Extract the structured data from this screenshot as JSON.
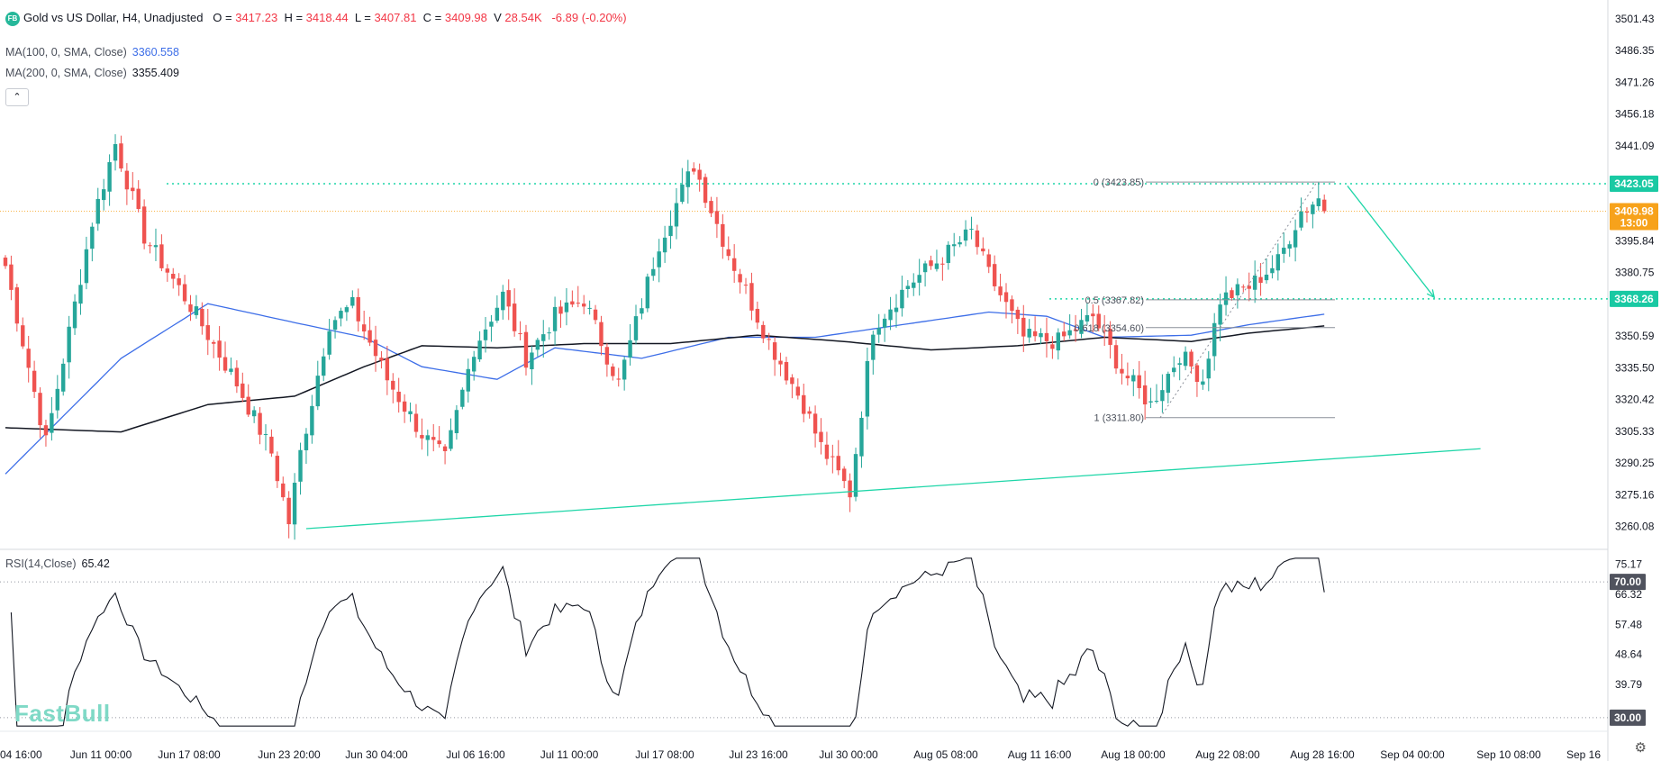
{
  "header": {
    "logo": "FB",
    "symbol_title": "Gold vs US Dollar, H4, Unadjusted",
    "ohlc": [
      {
        "key": "O",
        "value": "3417.23"
      },
      {
        "key": "H",
        "value": "3418.44"
      },
      {
        "key": "L",
        "value": "3407.81"
      },
      {
        "key": "C",
        "value": "3409.98"
      },
      {
        "key": "V",
        "value": "28.54K"
      }
    ],
    "change": "-6.89 (-0.20%)"
  },
  "indicators": {
    "ma100_label": "MA(100, 0, SMA, Close)",
    "ma100_value": "3360.558",
    "ma200_label": "MA(200, 0, SMA, Close)",
    "ma200_value": "3355.409",
    "rsi_label": "RSI(14,Close)",
    "rsi_value": "65.42",
    "collapse_icon": "chevron-up-icon"
  },
  "watermark": "FastBull",
  "colors": {
    "up": "#26a69a",
    "down": "#ef5350",
    "ma100": "#3d6ee8",
    "ma200": "#131722",
    "teal": "#1fd6a8",
    "price_tag": "#f7a21b",
    "level_tag": "#19c9a3"
  },
  "chart_data": {
    "type": "candlestick",
    "price_axis": {
      "ticks": [
        "3501.43",
        "3486.35",
        "3471.26",
        "3456.18",
        "3441.09",
        "3395.84",
        "3380.75",
        "3350.59",
        "3335.50",
        "3320.42",
        "3305.33",
        "3290.25",
        "3275.16",
        "3260.08"
      ],
      "tick_values": [
        3501.43,
        3486.35,
        3471.26,
        3456.18,
        3441.09,
        3395.84,
        3380.75,
        3350.59,
        3335.5,
        3320.42,
        3305.33,
        3290.25,
        3275.16,
        3260.08
      ],
      "range": [
        3250,
        3507
      ]
    },
    "time_axis": [
      "04 16:00",
      "Jun 11 00:00",
      "Jun 17 08:00",
      "Jun 23 20:00",
      "Jun 30 04:00",
      "Jul 06 16:00",
      "Jul 11 00:00",
      "Jul 17 08:00",
      "Jul 23 16:00",
      "Jul 30 00:00",
      "Aug 05 08:00",
      "Aug 11 16:00",
      "Aug 18 00:00",
      "Aug 22 08:00",
      "Aug 28 16:00",
      "Sep 04 00:00",
      "Sep 10 08:00",
      "Sep 16"
    ],
    "key_prices": [
      {
        "label": "3423.05",
        "value": 3423.05,
        "style": "level"
      },
      {
        "label": "3409.98",
        "sub": "13:00",
        "value": 3409.98,
        "style": "last"
      },
      {
        "label": "3368.26",
        "value": 3368.26,
        "style": "level"
      }
    ],
    "fibonacci": [
      {
        "label": "0 (3423.85)",
        "value": 3423.85
      },
      {
        "label": "0.5 (3367.82)",
        "value": 3367.82
      },
      {
        "label": "0.618 (3354.60)",
        "value": 3354.6
      },
      {
        "label": "1 (3311.80)",
        "value": 3311.8
      }
    ],
    "anchors": [
      [
        0,
        3384
      ],
      [
        7,
        3300
      ],
      [
        15,
        3405
      ],
      [
        19,
        3442
      ],
      [
        24,
        3398
      ],
      [
        32,
        3365
      ],
      [
        40,
        3328
      ],
      [
        46,
        3295
      ],
      [
        49,
        3262
      ],
      [
        51,
        3295
      ],
      [
        56,
        3357
      ],
      [
        60,
        3365
      ],
      [
        66,
        3330
      ],
      [
        72,
        3304
      ],
      [
        76,
        3292
      ],
      [
        81,
        3345
      ],
      [
        86,
        3370
      ],
      [
        90,
        3340
      ],
      [
        95,
        3360
      ],
      [
        100,
        3368
      ],
      [
        106,
        3328
      ],
      [
        113,
        3395
      ],
      [
        119,
        3432
      ],
      [
        125,
        3390
      ],
      [
        132,
        3348
      ],
      [
        138,
        3318
      ],
      [
        141,
        3298
      ],
      [
        146,
        3276
      ],
      [
        150,
        3355
      ],
      [
        156,
        3375
      ],
      [
        162,
        3388
      ],
      [
        167,
        3400
      ],
      [
        170,
        3380
      ],
      [
        176,
        3350
      ],
      [
        182,
        3348
      ],
      [
        188,
        3360
      ],
      [
        193,
        3334
      ],
      [
        198,
        3318
      ],
      [
        203,
        3342
      ],
      [
        207,
        3330
      ],
      [
        210,
        3368
      ],
      [
        215,
        3374
      ],
      [
        220,
        3386
      ],
      [
        224,
        3410
      ],
      [
        227,
        3416
      ],
      [
        228,
        3409.98
      ]
    ],
    "ma100": [
      [
        0,
        3285
      ],
      [
        20,
        3340
      ],
      [
        35,
        3366
      ],
      [
        50,
        3357
      ],
      [
        62,
        3350
      ],
      [
        72,
        3336
      ],
      [
        85,
        3330
      ],
      [
        95,
        3345
      ],
      [
        110,
        3340
      ],
      [
        125,
        3350
      ],
      [
        140,
        3350
      ],
      [
        155,
        3356
      ],
      [
        170,
        3362
      ],
      [
        180,
        3360
      ],
      [
        190,
        3350
      ],
      [
        205,
        3351
      ],
      [
        215,
        3356
      ],
      [
        228,
        3361
      ]
    ],
    "ma200": [
      [
        0,
        3307
      ],
      [
        20,
        3305
      ],
      [
        35,
        3318
      ],
      [
        50,
        3322
      ],
      [
        62,
        3336
      ],
      [
        72,
        3346
      ],
      [
        85,
        3345
      ],
      [
        100,
        3347
      ],
      [
        115,
        3347
      ],
      [
        130,
        3351
      ],
      [
        145,
        3348
      ],
      [
        160,
        3344
      ],
      [
        175,
        3346
      ],
      [
        190,
        3350
      ],
      [
        205,
        3348
      ],
      [
        215,
        3352
      ],
      [
        228,
        3355.4
      ]
    ],
    "trendline_low": [
      [
        52,
        3259
      ],
      [
        255,
        3297
      ]
    ],
    "arrow": [
      [
        232,
        3422
      ],
      [
        247,
        3369
      ]
    ],
    "rsi": {
      "levels": [
        70,
        30
      ],
      "ticks": [
        "75.17",
        "66.32",
        "57.48",
        "48.64",
        "39.79"
      ],
      "tick_values": [
        75.17,
        66.32,
        57.48,
        48.64,
        39.79
      ],
      "level_tags": [
        "70.00",
        "30.00"
      ],
      "range": [
        26.5,
        78
      ],
      "last": 65.42
    }
  }
}
